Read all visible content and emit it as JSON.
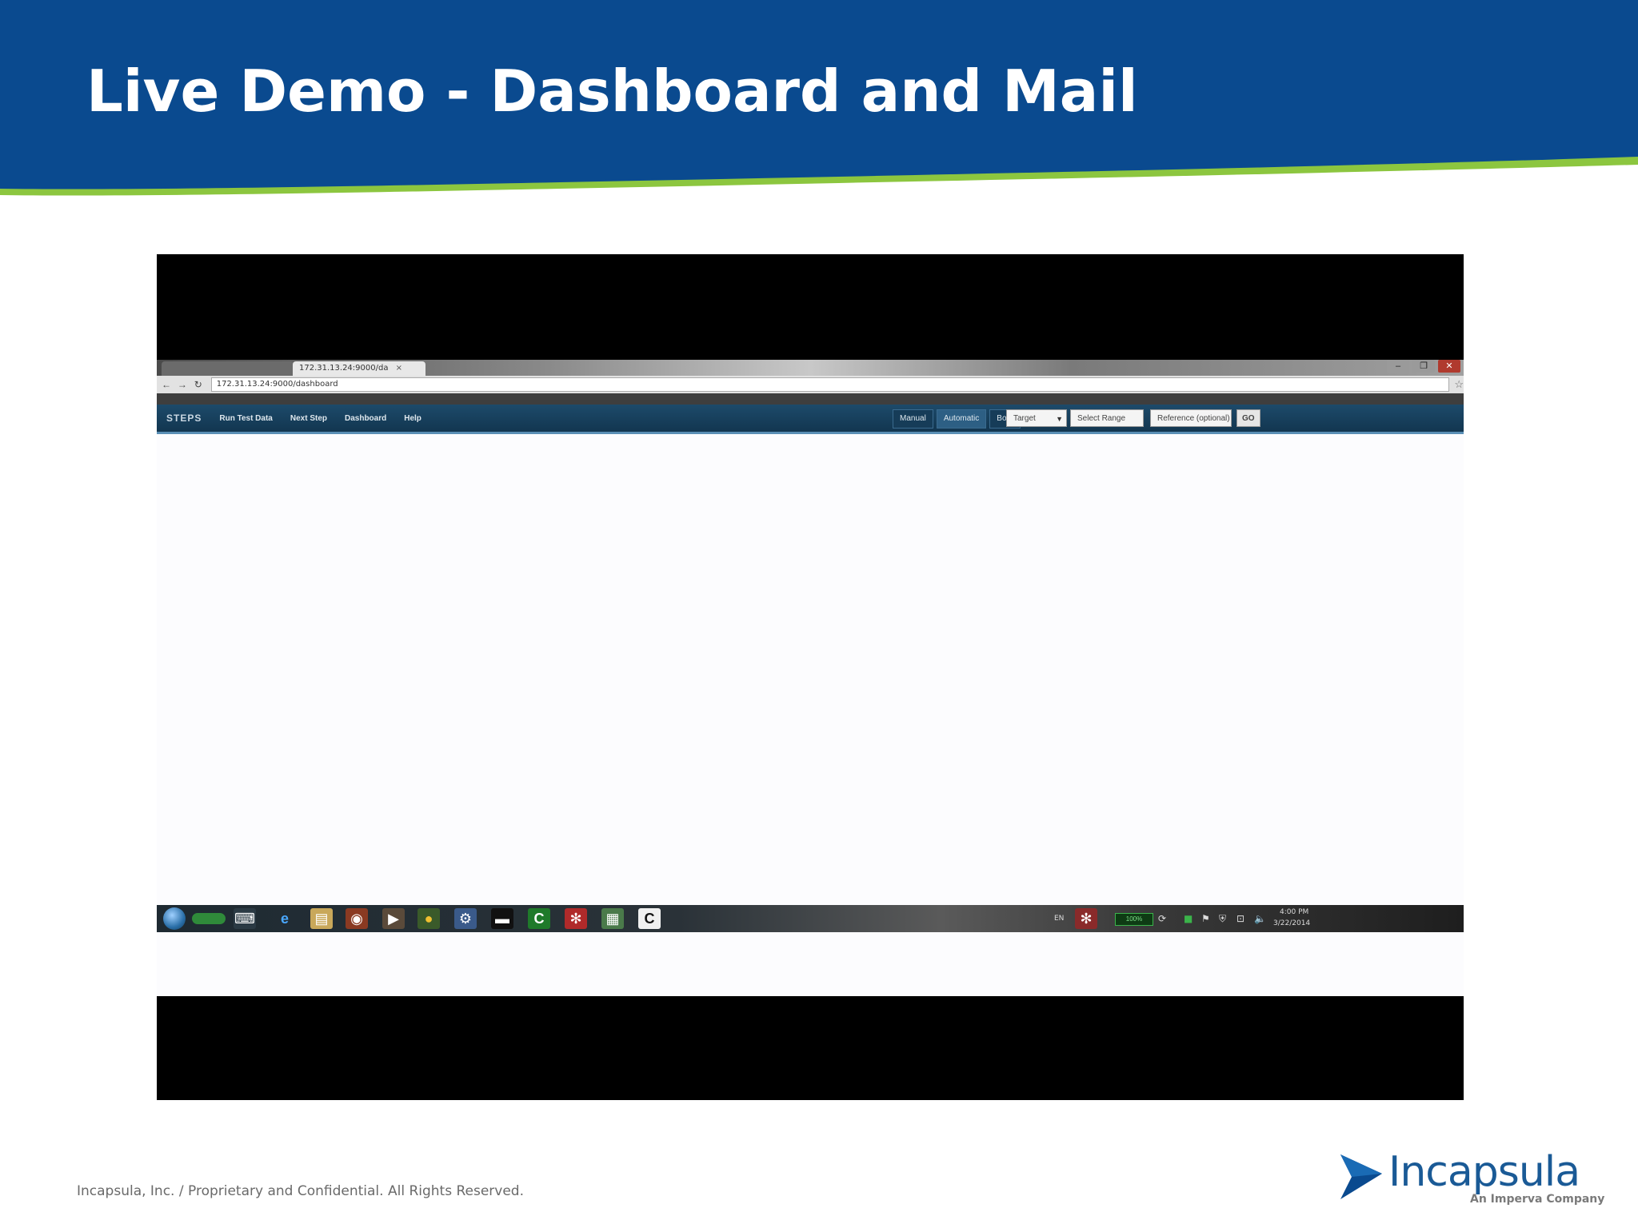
{
  "slide": {
    "title": "Live Demo - Dashboard and Mail",
    "footer": "Incapsula, Inc. /  Proprietary and Confidential. All Rights Reserved.",
    "logo": {
      "name": "Incapsula",
      "tagline": "An Imperva Company"
    },
    "colors": {
      "header_blue": "#0a4a8f",
      "header_green": "#8cc63f",
      "logo_blue": "#1a5a96"
    }
  },
  "video": {
    "browser": {
      "tabs": [
        {
          "label": "",
          "active": false
        },
        {
          "label": "172.31.13.24:9000/da",
          "active": true
        }
      ],
      "url": "172.31.13.24:9000/dashboard",
      "bookmarks": [
        "",
        "",
        "",
        "",
        "",
        ""
      ]
    },
    "app_nav": {
      "steps_label": "STEPS",
      "items": [
        "Run Test Data",
        "Next Step",
        "Dashboard",
        "Help"
      ],
      "mode_buttons": [
        "Manual",
        "Automatic",
        "Both"
      ],
      "selected_mode": "Automatic",
      "target_select": "Target",
      "start_input": "Select Range",
      "reference_input": "Reference (optional)",
      "go_label": "GO"
    },
    "taskbar": {
      "icons": [
        "start-orb",
        "ie-icon",
        "explorer-icon",
        "firefox-icon",
        "media-player-icon",
        "chrome-icon",
        "network-icon",
        "terminal-icon",
        "c-icon",
        "red-app-icon",
        "notepad-icon",
        "c-white-icon"
      ],
      "language": "EN",
      "battery": "100%",
      "time": "4:00 PM",
      "date": "3/22/2014"
    }
  }
}
